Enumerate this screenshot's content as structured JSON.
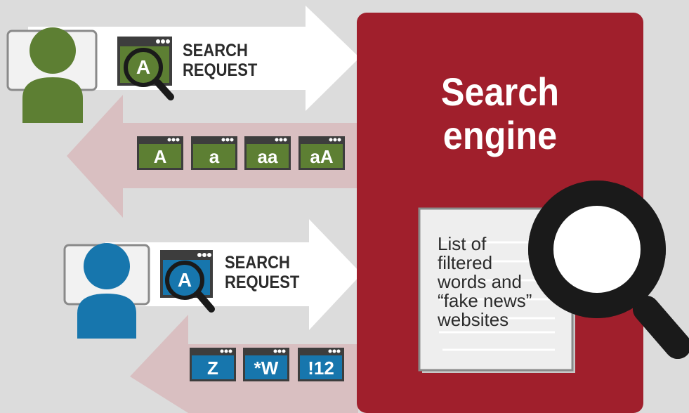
{
  "request_label_line1": "SEARCH",
  "request_label_line2": "REQUEST",
  "search_letter": "A",
  "engine": {
    "title_line1": "Search",
    "title_line2": "engine",
    "list_lines": [
      "List of",
      "filtered",
      "words and",
      "“fake news”",
      "websites"
    ]
  },
  "top_results": [
    "A",
    "a",
    "aa",
    "aA"
  ],
  "bottom_results": [
    "Z",
    "*W",
    "!12"
  ],
  "colors": {
    "background": "#dcdcdc",
    "engine_red": "#a01f2c",
    "user1_green": "#5d7f33",
    "user2_blue": "#1776ad",
    "arrow_pink": "#d9bfc1",
    "arrow_white": "#ffffff"
  },
  "icons": [
    "user-icon",
    "monitor-icon",
    "magnifier-icon",
    "browser-window-icon"
  ]
}
